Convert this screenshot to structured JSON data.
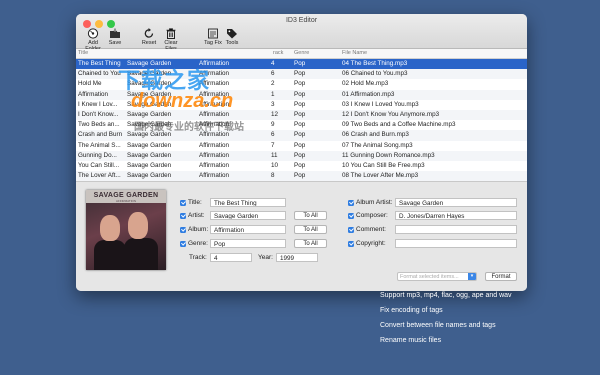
{
  "window": {
    "title": "ID3 Editor"
  },
  "toolbar": {
    "add_folder": "Add Folder",
    "save": "Save",
    "reset": "Reset",
    "clear_files": "Clear Files",
    "tag_fix": "Tag Fix",
    "tools": "Tools"
  },
  "columns": {
    "title": "Title",
    "track": "rack",
    "genre": "Genre",
    "file_name": "File Name"
  },
  "rows": [
    {
      "title": "The Best Thing",
      "artist": "Savage Garden",
      "album": "Affirmation",
      "track": "4",
      "genre": "Pop",
      "file": "04 The Best Thing.mp3"
    },
    {
      "title": "Chained to You",
      "artist": "Savage Garden",
      "album": "Affirmation",
      "track": "6",
      "genre": "Pop",
      "file": "06 Chained to You.mp3"
    },
    {
      "title": "Hold Me",
      "artist": "Savage Garden",
      "album": "Affirmation",
      "track": "2",
      "genre": "Pop",
      "file": "02 Hold Me.mp3"
    },
    {
      "title": "Affirmation",
      "artist": "Savage Garden",
      "album": "Affirmation",
      "track": "1",
      "genre": "Pop",
      "file": "01 Affirmation.mp3"
    },
    {
      "title": "I Knew I Lov...",
      "artist": "Savage Garden",
      "album": "Affirmation",
      "track": "3",
      "genre": "Pop",
      "file": "03 I Knew I Loved You.mp3"
    },
    {
      "title": "I Don't Know...",
      "artist": "Savage Garden",
      "album": "Affirmation",
      "track": "12",
      "genre": "Pop",
      "file": "12 I Don't Know You Anymore.mp3"
    },
    {
      "title": "Two Beds an...",
      "artist": "Savage Garden",
      "album": "Affirmation",
      "track": "9",
      "genre": "Pop",
      "file": "09 Two Beds and a Coffee Machine.mp3"
    },
    {
      "title": "Crash and Burn",
      "artist": "Savage Garden",
      "album": "Affirmation",
      "track": "6",
      "genre": "Pop",
      "file": "06 Crash and Burn.mp3"
    },
    {
      "title": "The Animal S...",
      "artist": "Savage Garden",
      "album": "Affirmation",
      "track": "7",
      "genre": "Pop",
      "file": "07 The Animal Song.mp3"
    },
    {
      "title": "Gunning Do...",
      "artist": "Savage Garden",
      "album": "Affirmation",
      "track": "11",
      "genre": "Pop",
      "file": "11 Gunning Down Romance.mp3"
    },
    {
      "title": "You Can Still...",
      "artist": "Savage Garden",
      "album": "Affirmation",
      "track": "10",
      "genre": "Pop",
      "file": "10 You Can Still Be Free.mp3"
    },
    {
      "title": "The Lover Aft...",
      "artist": "Savage Garden",
      "album": "Affirmation",
      "track": "8",
      "genre": "Pop",
      "file": "08 The Lover After Me.mp3"
    }
  ],
  "cover": {
    "band": "SAVAGE GARDEN",
    "subtitle": "AFFIRMATION"
  },
  "editor": {
    "title_label": "Title:",
    "title_value": "The Best Thing",
    "artist_label": "Artist:",
    "artist_value": "Savage Garden",
    "album_label": "Album:",
    "album_value": "Affirmation",
    "genre_label": "Genre:",
    "genre_value": "Pop",
    "track_label": "Track:",
    "track_value": "4",
    "year_label": "Year:",
    "year_value": "1999",
    "to_all": "To All",
    "album_artist_label": "Album Artist:",
    "album_artist_value": "Savage Garden",
    "composer_label": "Composer:",
    "composer_value": "D. Jones/Darren Hayes",
    "comment_label": "Comment:",
    "comment_value": "",
    "copyright_label": "Copyright:",
    "copyright_value": "",
    "format_placeholder": "Format selected items...",
    "format_button": "Format"
  },
  "features": [
    "Support mp3, mp4, flac, ogg, ape and wav",
    "Fix encoding of tags",
    "Convert between file names and tags",
    "Rename music files"
  ],
  "watermark": {
    "line1": "下载之家",
    "line2": "downza.cn",
    "line3": "国内最专业的软件下载站"
  },
  "colors": {
    "desktop": "#3f5f8e",
    "selection": "#2a64c8",
    "checkbox": "#2f7de1"
  }
}
